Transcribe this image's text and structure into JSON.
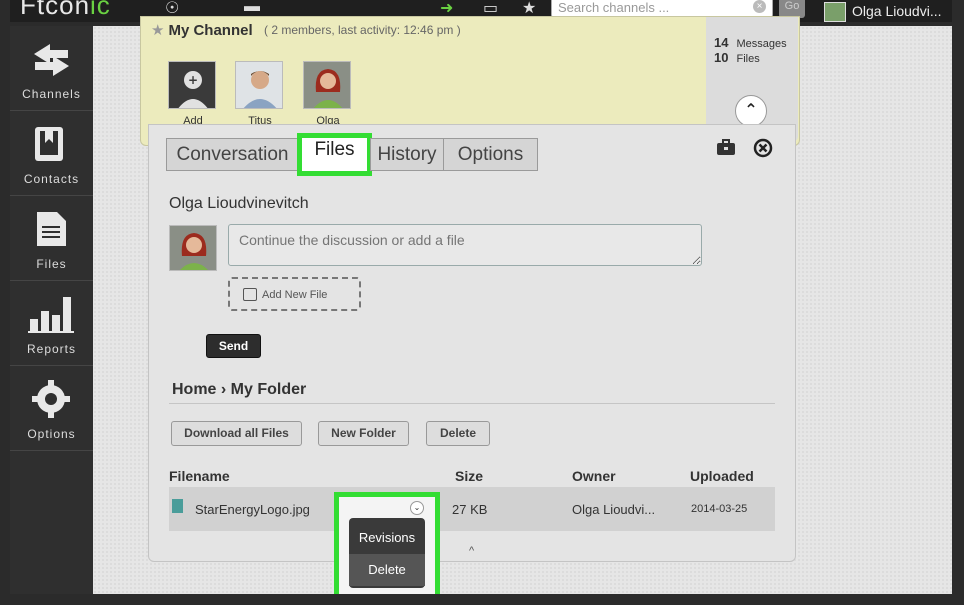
{
  "app": {
    "logo_text": "Ftcon",
    "logo_accent": "ic",
    "search_placeholder": "Search channels ...",
    "search_go": "Go",
    "user_name": "Olga Lioudvi..."
  },
  "sidebar": {
    "items": [
      {
        "label": "Channels",
        "icon": "arrows-icon"
      },
      {
        "label": "Contacts",
        "icon": "contacts-book-icon"
      },
      {
        "label": "Files",
        "icon": "file-icon"
      },
      {
        "label": "Reports",
        "icon": "bar-chart-icon"
      },
      {
        "label": "Options",
        "icon": "gear-icon"
      }
    ]
  },
  "channel": {
    "title": "My Channel",
    "meta": "( 2 members, last activity: 12:46 pm )",
    "members": [
      {
        "label": "Add"
      },
      {
        "label": "Titus"
      },
      {
        "label": "Olga"
      }
    ],
    "stats": {
      "messages_count": "14",
      "messages_label": "Messages",
      "files_count": "10",
      "files_label": "Files"
    }
  },
  "tabs": [
    {
      "label": "Conversation"
    },
    {
      "label": "Files"
    },
    {
      "label": "History"
    },
    {
      "label": "Options"
    }
  ],
  "compose": {
    "author": "Olga Lioudvinevitch",
    "placeholder": "Continue the discussion or add a file",
    "add_file_label": "Add New File",
    "send_label": "Send"
  },
  "files": {
    "breadcrumb": "Home › My Folder",
    "actions": {
      "download_all": "Download all Files",
      "new_folder": "New Folder",
      "delete": "Delete"
    },
    "columns": [
      "Filename",
      "Size",
      "Owner",
      "Uploaded"
    ],
    "rows": [
      {
        "filename": "StarEnergyLogo.jpg",
        "size": "27 KB",
        "owner": "Olga Lioudvi...",
        "uploaded": "2014-03-25"
      }
    ],
    "scroll_glyph": "^"
  },
  "context_menu": {
    "items": [
      "Revisions",
      "Delete"
    ]
  },
  "colors": {
    "highlight": "#33dd33",
    "channel_bg": "#ecebbd",
    "sidebar_bg": "#2f2f2f"
  }
}
